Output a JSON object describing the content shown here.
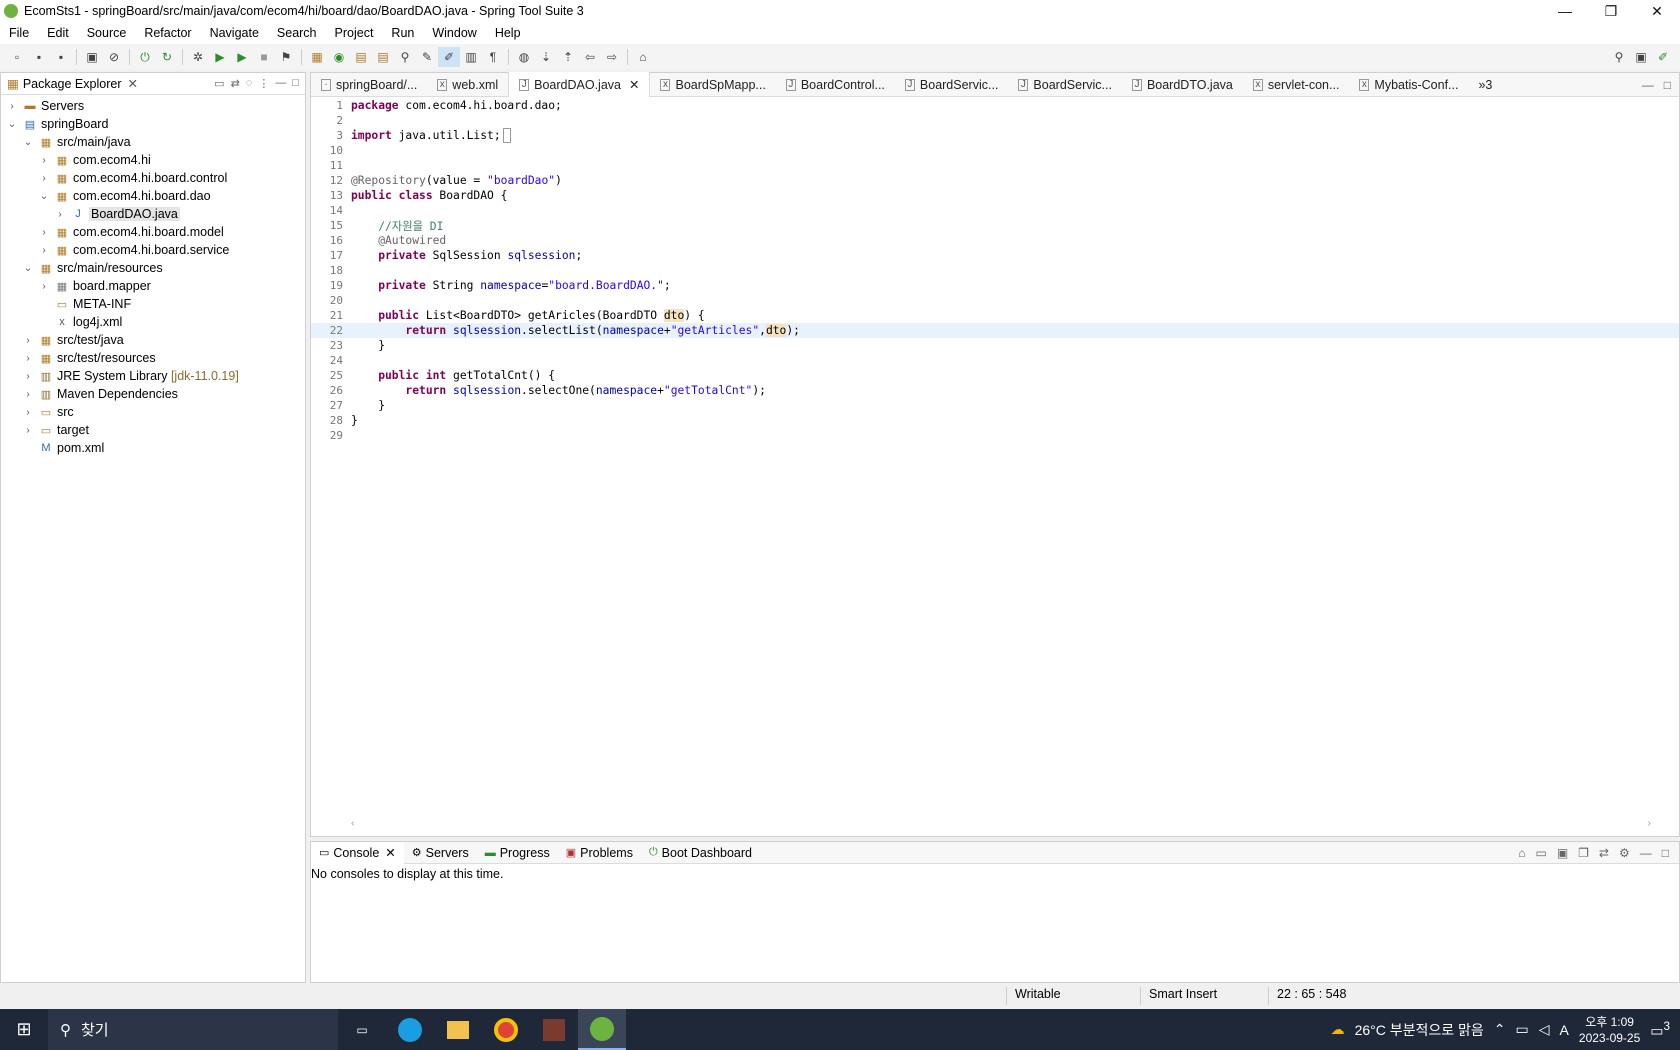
{
  "window": {
    "title": "EcomSts1 - springBoard/src/main/java/com/ecom4/hi/board/dao/BoardDAO.java - Spring Tool Suite 3"
  },
  "menu": [
    "File",
    "Edit",
    "Source",
    "Refactor",
    "Navigate",
    "Search",
    "Project",
    "Run",
    "Window",
    "Help"
  ],
  "package_explorer": {
    "title": "Package Explorer",
    "items": [
      {
        "label": "Servers",
        "extra": ""
      },
      {
        "label": "springBoard",
        "extra": ""
      },
      {
        "label": "src/main/java",
        "extra": ""
      },
      {
        "label": "com.ecom4.hi",
        "extra": ""
      },
      {
        "label": "com.ecom4.hi.board.control",
        "extra": ""
      },
      {
        "label": "com.ecom4.hi.board.dao",
        "extra": ""
      },
      {
        "label": "BoardDAO.java",
        "extra": ""
      },
      {
        "label": "com.ecom4.hi.board.model",
        "extra": ""
      },
      {
        "label": "com.ecom4.hi.board.service",
        "extra": ""
      },
      {
        "label": "src/main/resources",
        "extra": ""
      },
      {
        "label": "board.mapper",
        "extra": ""
      },
      {
        "label": "META-INF",
        "extra": ""
      },
      {
        "label": "log4j.xml",
        "extra": ""
      },
      {
        "label": "src/test/java",
        "extra": ""
      },
      {
        "label": "src/test/resources",
        "extra": ""
      },
      {
        "label": "JRE System Library",
        "extra": "[jdk-11.0.19]"
      },
      {
        "label": "Maven Dependencies",
        "extra": ""
      },
      {
        "label": "src",
        "extra": ""
      },
      {
        "label": "target",
        "extra": ""
      },
      {
        "label": "pom.xml",
        "extra": ""
      }
    ]
  },
  "editor_tabs": [
    "springBoard/...",
    "web.xml",
    "BoardDAO.java",
    "BoardSpMapp...",
    "BoardControl...",
    "BoardServic...",
    "BoardServic...",
    "BoardDTO.java",
    "servlet-con...",
    "Mybatis-Conf...",
    "»3"
  ],
  "code_lines": [
    "1",
    "2",
    "3",
    "10",
    "11",
    "12",
    "13",
    "14",
    "15",
    "16",
    "17",
    "18",
    "19",
    "20",
    "21",
    "22",
    "23",
    "24",
    "25",
    "26",
    "27",
    "28",
    "29"
  ],
  "code": {
    "l1a": "package",
    "l1b": " com.ecom4.hi.board.dao;",
    "l3a": "import",
    "l3b": " java.util.List;",
    "l12a": "@Repository",
    "l12b": "(value = ",
    "l12c": "\"boardDao\"",
    "l12d": ")",
    "l13a": "public class",
    "l13b": " BoardDAO {",
    "l15": "    //자원을 DI",
    "l16": "    @Autowired",
    "l17a": "    private",
    "l17b": " SqlSession ",
    "l17c": "sqlsession",
    "l17d": ";",
    "l19a": "    private",
    "l19b": " String ",
    "l19c": "namespace",
    "l19d": "=",
    "l19e": "\"board.BoardDAO.\"",
    "l19f": ";",
    "l21a": "    public",
    "l21b": " List<BoardDTO> getAricles(BoardDTO ",
    "l21c": "dto",
    "l21d": ") {",
    "l22a": "        return",
    "l22b": " ",
    "l22c": "sqlsession",
    "l22d": ".selectList(",
    "l22e": "namespace",
    "l22f": "+",
    "l22g": "\"getArticles\"",
    "l22h": ",",
    "l22i": "dto",
    "l22j": ");",
    "l23": "    }",
    "l25a": "    public int",
    "l25b": " getTotalCnt() {",
    "l26a": "        return",
    "l26b": " ",
    "l26c": "sqlsession",
    "l26d": ".selectOne(",
    "l26e": "namespace",
    "l26f": "+",
    "l26g": "\"getTotalCnt\"",
    "l26h": ");",
    "l27": "    }",
    "l28": "}"
  },
  "console": {
    "tabs": [
      "Console",
      "Servers",
      "Progress",
      "Problems",
      "Boot Dashboard"
    ],
    "message": "No consoles to display at this time."
  },
  "status": {
    "writable": "Writable",
    "insert": "Smart Insert",
    "position": "22 : 65 : 548"
  },
  "taskbar": {
    "search": "찾기",
    "weather": "26°C 부분적으로 맑음",
    "time": "오후 1:09",
    "date": "2023-09-25",
    "ime": "A",
    "notif": "3"
  }
}
